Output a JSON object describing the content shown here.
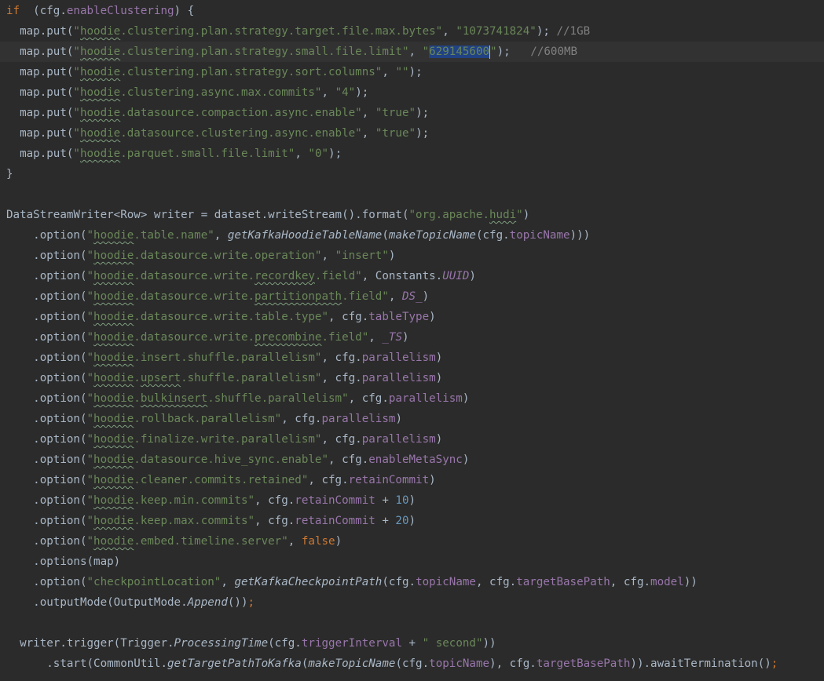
{
  "editor": {
    "lines": [
      [
        [
          "kw",
          "if "
        ],
        [
          "p",
          " (cfg."
        ],
        [
          "field",
          "enableClustering"
        ],
        [
          "p",
          ") {"
        ]
      ],
      [
        [
          "p",
          "  map.put("
        ],
        [
          "str",
          "\""
        ],
        [
          "str_typo",
          "hoodie"
        ],
        [
          "str",
          ".clustering.plan.strategy.target.file.max.bytes\""
        ],
        [
          "p",
          ", "
        ],
        [
          "str",
          "\"1073741824\""
        ],
        [
          "p",
          ");"
        ],
        [
          "cmt",
          " //1GB"
        ]
      ],
      [
        [
          "p",
          "  map.put("
        ],
        [
          "str",
          "\""
        ],
        [
          "str_typo",
          "hoodie"
        ],
        [
          "str",
          ".clustering.plan.strategy.small.file.limit\""
        ],
        [
          "p",
          ", "
        ],
        [
          "str",
          "\""
        ],
        [
          "sel",
          "629145600"
        ],
        [
          "caret",
          ""
        ],
        [
          "str",
          "\""
        ],
        [
          "p",
          ");  "
        ],
        [
          "cmt",
          " //600MB"
        ]
      ],
      [
        [
          "p",
          "  map.put("
        ],
        [
          "str",
          "\""
        ],
        [
          "str_typo",
          "hoodie"
        ],
        [
          "str",
          ".clustering.plan.strategy.sort.columns\""
        ],
        [
          "p",
          ", "
        ],
        [
          "str",
          "\"\""
        ],
        [
          "p",
          ");"
        ]
      ],
      [
        [
          "p",
          "  map.put("
        ],
        [
          "str",
          "\""
        ],
        [
          "str_typo",
          "hoodie"
        ],
        [
          "str",
          ".clustering.async.max.commits\""
        ],
        [
          "p",
          ", "
        ],
        [
          "str",
          "\"4\""
        ],
        [
          "p",
          ");"
        ]
      ],
      [
        [
          "p",
          "  map.put("
        ],
        [
          "str",
          "\""
        ],
        [
          "str_typo",
          "hoodie"
        ],
        [
          "str",
          ".datasource.compaction.async.enable\""
        ],
        [
          "p",
          ", "
        ],
        [
          "str",
          "\"true\""
        ],
        [
          "p",
          ");"
        ]
      ],
      [
        [
          "p",
          "  map.put("
        ],
        [
          "str",
          "\""
        ],
        [
          "str_typo",
          "hoodie"
        ],
        [
          "str",
          ".datasource.clustering.async.enable\""
        ],
        [
          "p",
          ", "
        ],
        [
          "str",
          "\"true\""
        ],
        [
          "p",
          ");"
        ]
      ],
      [
        [
          "p",
          "  map.put("
        ],
        [
          "str",
          "\""
        ],
        [
          "str_typo",
          "hoodie"
        ],
        [
          "str",
          ".parquet.small.file.limit\""
        ],
        [
          "p",
          ", "
        ],
        [
          "str",
          "\"0\""
        ],
        [
          "p",
          ");"
        ]
      ],
      [
        [
          "p",
          "}"
        ]
      ],
      [],
      [
        [
          "p",
          "DataStreamWriter<Row> writer = dataset.writeStream().format("
        ],
        [
          "str",
          "\"org.apache."
        ],
        [
          "str_typo",
          "hudi"
        ],
        [
          "str",
          "\""
        ],
        [
          "p",
          ")"
        ]
      ],
      [
        [
          "p",
          "    .option("
        ],
        [
          "str",
          "\""
        ],
        [
          "str_typo",
          "hoodie"
        ],
        [
          "str",
          ".table.name\""
        ],
        [
          "p",
          ", "
        ],
        [
          "ital",
          "getKafkaHoodieTableName"
        ],
        [
          "p",
          "("
        ],
        [
          "ital",
          "makeTopicName"
        ],
        [
          "p",
          "(cfg."
        ],
        [
          "field",
          "topicName"
        ],
        [
          "p",
          ")))"
        ]
      ],
      [
        [
          "p",
          "    .option("
        ],
        [
          "str",
          "\""
        ],
        [
          "str_typo",
          "hoodie"
        ],
        [
          "str",
          ".datasource.write.operation\""
        ],
        [
          "p",
          ", "
        ],
        [
          "str",
          "\"insert\""
        ],
        [
          "p",
          ")"
        ]
      ],
      [
        [
          "p",
          "    .option("
        ],
        [
          "str",
          "\""
        ],
        [
          "str_typo",
          "hoodie"
        ],
        [
          "str",
          ".datasource.write."
        ],
        [
          "str_typo",
          "recordkey"
        ],
        [
          "str",
          ".field\""
        ],
        [
          "p",
          ", Constants."
        ],
        [
          "stat",
          "UUID"
        ],
        [
          "p",
          ")"
        ]
      ],
      [
        [
          "p",
          "    .option("
        ],
        [
          "str",
          "\""
        ],
        [
          "str_typo",
          "hoodie"
        ],
        [
          "str",
          ".datasource.write."
        ],
        [
          "str_typo",
          "partitionpath"
        ],
        [
          "str",
          ".field\""
        ],
        [
          "p",
          ", "
        ],
        [
          "stat",
          "DS_"
        ],
        [
          "p",
          ")"
        ]
      ],
      [
        [
          "p",
          "    .option("
        ],
        [
          "str",
          "\""
        ],
        [
          "str_typo",
          "hoodie"
        ],
        [
          "str",
          ".datasource.write.table.type\""
        ],
        [
          "p",
          ", cfg."
        ],
        [
          "field",
          "tableType"
        ],
        [
          "p",
          ")"
        ]
      ],
      [
        [
          "p",
          "    .option("
        ],
        [
          "str",
          "\""
        ],
        [
          "str_typo",
          "hoodie"
        ],
        [
          "str",
          ".datasource.write."
        ],
        [
          "str_typo",
          "precombine"
        ],
        [
          "str",
          ".field\""
        ],
        [
          "p",
          ", "
        ],
        [
          "stat",
          "_TS"
        ],
        [
          "p",
          ")"
        ]
      ],
      [
        [
          "p",
          "    .option("
        ],
        [
          "str",
          "\""
        ],
        [
          "str_typo",
          "hoodie"
        ],
        [
          "str",
          ".insert.shuffle.parallelism\""
        ],
        [
          "p",
          ", cfg."
        ],
        [
          "field",
          "parallelism"
        ],
        [
          "p",
          ")"
        ]
      ],
      [
        [
          "p",
          "    .option("
        ],
        [
          "str",
          "\""
        ],
        [
          "str_typo",
          "hoodie"
        ],
        [
          "str",
          "."
        ],
        [
          "str_typo",
          "upsert"
        ],
        [
          "str",
          ".shuffle.parallelism\""
        ],
        [
          "p",
          ", cfg."
        ],
        [
          "field",
          "parallelism"
        ],
        [
          "p",
          ")"
        ]
      ],
      [
        [
          "p",
          "    .option("
        ],
        [
          "str",
          "\""
        ],
        [
          "str_typo",
          "hoodie"
        ],
        [
          "str",
          "."
        ],
        [
          "str_typo",
          "bulkinsert"
        ],
        [
          "str",
          ".shuffle.parallelism\""
        ],
        [
          "p",
          ", cfg."
        ],
        [
          "field",
          "parallelism"
        ],
        [
          "p",
          ")"
        ]
      ],
      [
        [
          "p",
          "    .option("
        ],
        [
          "str",
          "\""
        ],
        [
          "str_typo",
          "hoodie"
        ],
        [
          "str",
          ".rollback.parallelism\""
        ],
        [
          "p",
          ", cfg."
        ],
        [
          "field",
          "parallelism"
        ],
        [
          "p",
          ")"
        ]
      ],
      [
        [
          "p",
          "    .option("
        ],
        [
          "str",
          "\""
        ],
        [
          "str_typo",
          "hoodie"
        ],
        [
          "str",
          ".finalize.write.parallelism\""
        ],
        [
          "p",
          ", cfg."
        ],
        [
          "field",
          "parallelism"
        ],
        [
          "p",
          ")"
        ]
      ],
      [
        [
          "p",
          "    .option("
        ],
        [
          "str",
          "\""
        ],
        [
          "str_typo",
          "hoodie"
        ],
        [
          "str",
          ".datasource.hive_sync.enable\""
        ],
        [
          "p",
          ", cfg."
        ],
        [
          "field",
          "enableMetaSync"
        ],
        [
          "p",
          ")"
        ]
      ],
      [
        [
          "p",
          "    .option("
        ],
        [
          "str",
          "\""
        ],
        [
          "str_typo",
          "hoodie"
        ],
        [
          "str",
          ".cleaner.commits.retained\""
        ],
        [
          "p",
          ", cfg."
        ],
        [
          "field",
          "retainCommit"
        ],
        [
          "p",
          ")"
        ]
      ],
      [
        [
          "p",
          "    .option("
        ],
        [
          "str",
          "\""
        ],
        [
          "str_typo",
          "hoodie"
        ],
        [
          "str",
          ".keep.min.commits\""
        ],
        [
          "p",
          ", cfg."
        ],
        [
          "field",
          "retainCommit"
        ],
        [
          "p",
          " + "
        ],
        [
          "num",
          "10"
        ],
        [
          "p",
          ")"
        ]
      ],
      [
        [
          "p",
          "    .option("
        ],
        [
          "str",
          "\""
        ],
        [
          "str_typo",
          "hoodie"
        ],
        [
          "str",
          ".keep.max.commits\""
        ],
        [
          "p",
          ", cfg."
        ],
        [
          "field",
          "retainCommit"
        ],
        [
          "p",
          " + "
        ],
        [
          "num",
          "20"
        ],
        [
          "p",
          ")"
        ]
      ],
      [
        [
          "p",
          "    .option("
        ],
        [
          "str",
          "\""
        ],
        [
          "str_typo",
          "hoodie"
        ],
        [
          "str",
          ".embed.timeline.server\""
        ],
        [
          "p",
          ", "
        ],
        [
          "kw",
          "false"
        ],
        [
          "p",
          ")"
        ]
      ],
      [
        [
          "p",
          "    .options(map)"
        ]
      ],
      [
        [
          "p",
          "    .option("
        ],
        [
          "str",
          "\"checkpointLocation\""
        ],
        [
          "p",
          ", "
        ],
        [
          "ital",
          "getKafkaCheckpointPath"
        ],
        [
          "p",
          "(cfg."
        ],
        [
          "field",
          "topicName"
        ],
        [
          "p",
          ", cfg."
        ],
        [
          "field",
          "targetBasePath"
        ],
        [
          "p",
          ", cfg."
        ],
        [
          "field",
          "model"
        ],
        [
          "p",
          "))"
        ]
      ],
      [
        [
          "p",
          "    .outputMode(OutputMode."
        ],
        [
          "ital",
          "Append"
        ],
        [
          "p",
          "())"
        ],
        [
          "kw",
          ";"
        ]
      ],
      [],
      [
        [
          "p",
          "  writer.trigger(Trigger."
        ],
        [
          "ital",
          "ProcessingTime"
        ],
        [
          "p",
          "(cfg."
        ],
        [
          "field",
          "triggerInterval"
        ],
        [
          "p",
          " + "
        ],
        [
          "str",
          "\" second\""
        ],
        [
          "p",
          "))"
        ]
      ],
      [
        [
          "p",
          "      .start(CommonUtil."
        ],
        [
          "ital",
          "getTargetPathToKafka"
        ],
        [
          "p",
          "("
        ],
        [
          "ital",
          "makeTopicName"
        ],
        [
          "p",
          "(cfg."
        ],
        [
          "field",
          "topicName"
        ],
        [
          "p",
          "), cfg."
        ],
        [
          "field",
          "targetBasePath"
        ],
        [
          "p",
          ")).awaitTermination()"
        ],
        [
          "kw",
          ";"
        ]
      ]
    ]
  },
  "colors": {
    "background": "#2b2b2b",
    "text": "#a9b7c6",
    "keyword": "#cc7832",
    "string": "#6a8759",
    "field": "#9876aa",
    "number": "#6897bb",
    "comment": "#808080",
    "selection": "#214283",
    "current_line": "#323232"
  }
}
